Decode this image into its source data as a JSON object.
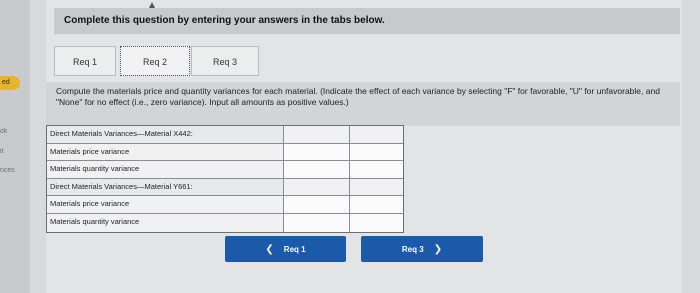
{
  "sidebar": {
    "badge": "ed",
    "labels": [
      "ok",
      "it",
      "nces"
    ]
  },
  "header": {
    "instruction": "Complete this question by entering your answers in the tabs below."
  },
  "tabs": [
    {
      "label": "Req 1"
    },
    {
      "label": "Req 2"
    },
    {
      "label": "Req 3"
    }
  ],
  "prompt": {
    "text": "Compute the materials price and quantity variances for each material. (Indicate the effect of each variance by selecting \"F\" for favorable, \"U\" for unfavorable, and \"None\" for no effect (i.e., zero variance). Input all amounts as positive values.)"
  },
  "table": {
    "rows": [
      {
        "label": "Direct Materials Variances—Material X442:",
        "heading": true
      },
      {
        "label": "Materials price variance",
        "heading": false
      },
      {
        "label": "Materials quantity variance",
        "heading": false
      },
      {
        "label": "Direct Materials Variances—Material Y661:",
        "heading": true
      },
      {
        "label": "Materials price variance",
        "heading": false
      },
      {
        "label": "Materials quantity variance",
        "heading": false
      }
    ]
  },
  "navigation": {
    "prev_label": "Req 1",
    "next_label": "Req 3"
  }
}
